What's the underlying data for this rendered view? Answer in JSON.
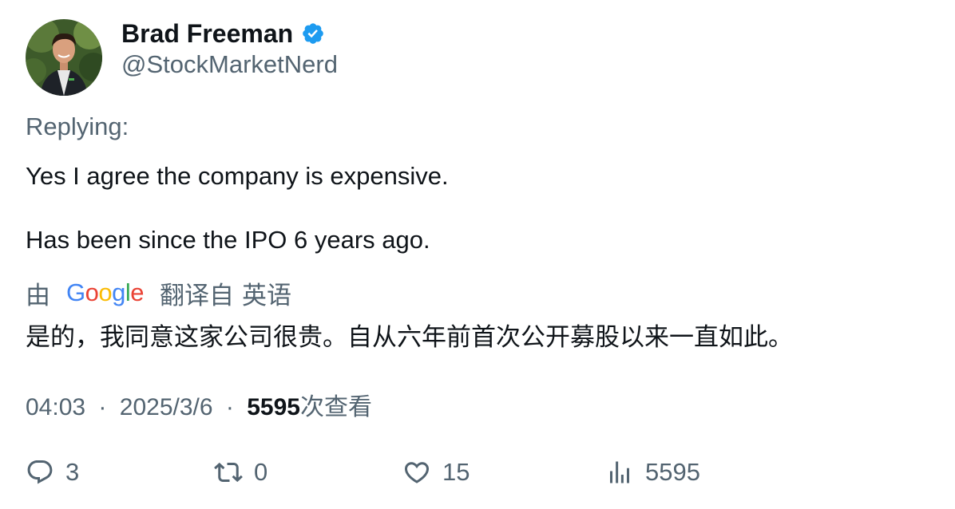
{
  "author": {
    "display_name": "Brad Freeman",
    "handle": "@StockMarketNerd",
    "verified": true,
    "verified_color": "#1d9bf0"
  },
  "replying_label": "Replying:",
  "tweet": {
    "lines": [
      "Yes I agree the company is expensive.",
      "Has been since the IPO 6 years ago."
    ]
  },
  "translation": {
    "prefix": "由",
    "provider_logo": "Google",
    "label": "翻译自",
    "language": "英语",
    "text": "是的，我同意这家公司很贵。自从六年前首次公开募股以来一直如此。"
  },
  "meta": {
    "time": "04:03",
    "separator": "·",
    "date": "2025/3/6",
    "views_count": "5595",
    "views_label": "次查看"
  },
  "actions": {
    "replies": "3",
    "retweets": "0",
    "likes": "15",
    "views": "5595"
  },
  "icons": {
    "reply": "reply-icon",
    "retweet": "retweet-icon",
    "like": "heart-icon",
    "views": "analytics-icon",
    "verified": "verified-badge-icon"
  }
}
